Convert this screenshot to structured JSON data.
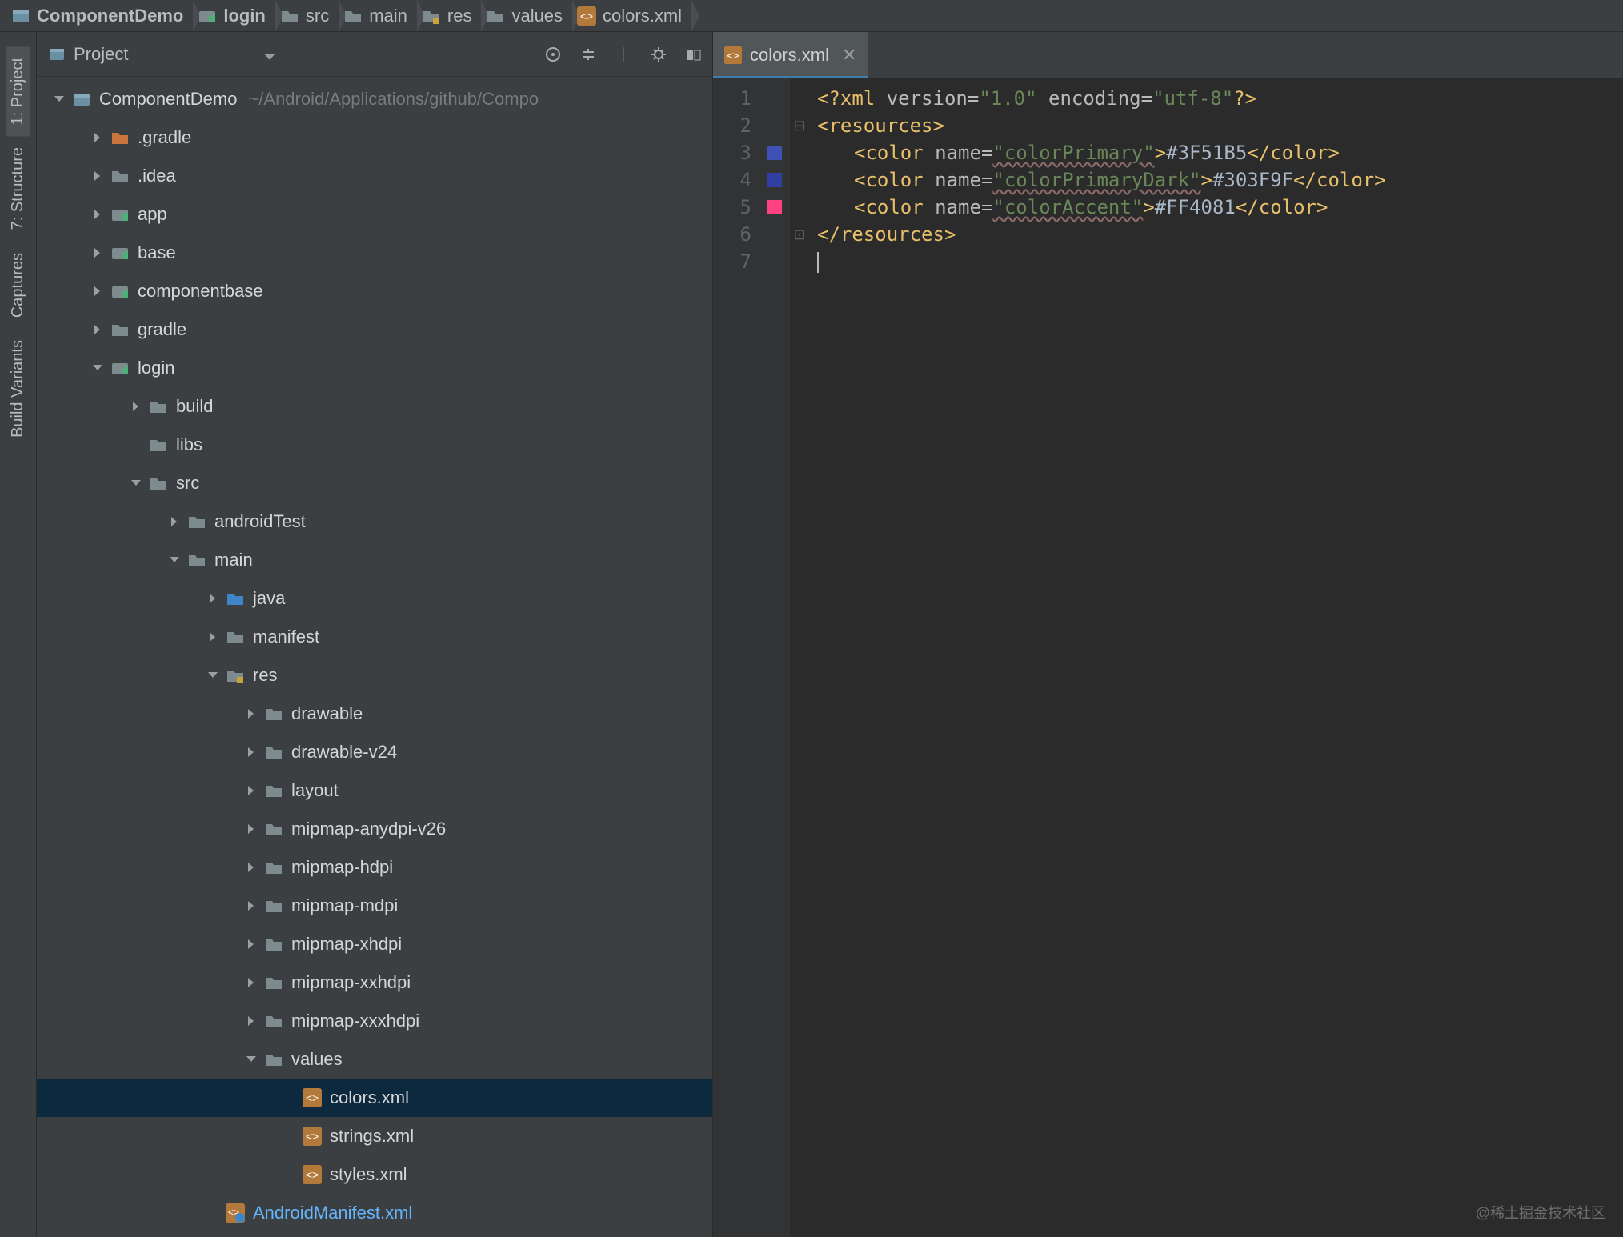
{
  "breadcrumb": [
    {
      "label": "ComponentDemo",
      "icon": "project",
      "bold": true
    },
    {
      "label": "login",
      "icon": "module",
      "bold": true
    },
    {
      "label": "src",
      "icon": "folder",
      "bold": false
    },
    {
      "label": "main",
      "icon": "folder",
      "bold": false
    },
    {
      "label": "res",
      "icon": "resfolder",
      "bold": false
    },
    {
      "label": "values",
      "icon": "folder",
      "bold": false
    },
    {
      "label": "colors.xml",
      "icon": "xml",
      "bold": false
    }
  ],
  "sidebar": {
    "tabs": [
      {
        "label": "1: Project",
        "active": true
      },
      {
        "label": "7: Structure",
        "active": false
      },
      {
        "label": "Captures",
        "active": false
      },
      {
        "label": "Build Variants",
        "active": false
      }
    ]
  },
  "panel": {
    "title": "Project",
    "toolbar": [
      "target-icon",
      "collapse-icon",
      "divider",
      "gear-icon",
      "hide-icon"
    ]
  },
  "tree": [
    {
      "depth": 0,
      "arrow": "down",
      "icon": "project",
      "label": "ComponentDemo",
      "path": "~/Android/Applications/github/Compo"
    },
    {
      "depth": 1,
      "arrow": "right",
      "icon": "folder-orange",
      "label": ".gradle"
    },
    {
      "depth": 1,
      "arrow": "right",
      "icon": "folder",
      "label": ".idea"
    },
    {
      "depth": 1,
      "arrow": "right",
      "icon": "module",
      "label": "app"
    },
    {
      "depth": 1,
      "arrow": "right",
      "icon": "module",
      "label": "base"
    },
    {
      "depth": 1,
      "arrow": "right",
      "icon": "module",
      "label": "componentbase"
    },
    {
      "depth": 1,
      "arrow": "right",
      "icon": "folder",
      "label": "gradle"
    },
    {
      "depth": 1,
      "arrow": "down",
      "icon": "module",
      "label": "login"
    },
    {
      "depth": 2,
      "arrow": "right",
      "icon": "folder",
      "label": "build"
    },
    {
      "depth": 2,
      "arrow": "",
      "icon": "folder",
      "label": "libs"
    },
    {
      "depth": 2,
      "arrow": "down",
      "icon": "folder",
      "label": "src"
    },
    {
      "depth": 3,
      "arrow": "right",
      "icon": "folder",
      "label": "androidTest"
    },
    {
      "depth": 3,
      "arrow": "down",
      "icon": "folder",
      "label": "main"
    },
    {
      "depth": 4,
      "arrow": "right",
      "icon": "folder-blue",
      "label": "java"
    },
    {
      "depth": 4,
      "arrow": "right",
      "icon": "folder",
      "label": "manifest"
    },
    {
      "depth": 4,
      "arrow": "down",
      "icon": "resfolder",
      "label": "res"
    },
    {
      "depth": 5,
      "arrow": "right",
      "icon": "folder",
      "label": "drawable"
    },
    {
      "depth": 5,
      "arrow": "right",
      "icon": "folder",
      "label": "drawable-v24"
    },
    {
      "depth": 5,
      "arrow": "right",
      "icon": "folder",
      "label": "layout"
    },
    {
      "depth": 5,
      "arrow": "right",
      "icon": "folder",
      "label": "mipmap-anydpi-v26"
    },
    {
      "depth": 5,
      "arrow": "right",
      "icon": "folder",
      "label": "mipmap-hdpi"
    },
    {
      "depth": 5,
      "arrow": "right",
      "icon": "folder",
      "label": "mipmap-mdpi"
    },
    {
      "depth": 5,
      "arrow": "right",
      "icon": "folder",
      "label": "mipmap-xhdpi"
    },
    {
      "depth": 5,
      "arrow": "right",
      "icon": "folder",
      "label": "mipmap-xxhdpi"
    },
    {
      "depth": 5,
      "arrow": "right",
      "icon": "folder",
      "label": "mipmap-xxxhdpi"
    },
    {
      "depth": 5,
      "arrow": "down",
      "icon": "folder",
      "label": "values"
    },
    {
      "depth": 6,
      "arrow": "",
      "icon": "xml",
      "label": "colors.xml",
      "selected": true
    },
    {
      "depth": 6,
      "arrow": "",
      "icon": "xml",
      "label": "strings.xml"
    },
    {
      "depth": 6,
      "arrow": "",
      "icon": "xml",
      "label": "styles.xml"
    },
    {
      "depth": 4,
      "arrow": "",
      "icon": "xml-hl",
      "label": "AndroidManifest.xml",
      "hl": true
    }
  ],
  "editor": {
    "tab": {
      "label": "colors.xml"
    },
    "lines": [
      1,
      2,
      3,
      4,
      5,
      6,
      7
    ],
    "swatches": {
      "3": "#3F51B5",
      "4": "#303F9F",
      "5": "#FF4081"
    },
    "folds": {
      "2": "open",
      "6": "close"
    },
    "code": {
      "l1": {
        "decl1": "<?",
        "kw": "xml",
        "attr1": " version=",
        "str1": "\"1.0\"",
        "attr2": " encoding=",
        "str2": "\"utf-8\"",
        "decl2": "?>"
      },
      "l2": {
        "open": "<resources>"
      },
      "l3": {
        "open": "<color ",
        "attr": "name=",
        "str": "\"colorPrimary\"",
        "gt": ">",
        "val": "#3F51B5",
        "close": "</color>"
      },
      "l4": {
        "open": "<color ",
        "attr": "name=",
        "str": "\"colorPrimaryDark\"",
        "gt": ">",
        "val": "#303F9F",
        "close": "</color>"
      },
      "l5": {
        "open": "<color ",
        "attr": "name=",
        "str": "\"colorAccent\"",
        "gt": ">",
        "val": "#FF4081",
        "close": "</color>"
      },
      "l6": {
        "close": "</resources>"
      }
    }
  },
  "watermark": "@稀土掘金技术社区"
}
